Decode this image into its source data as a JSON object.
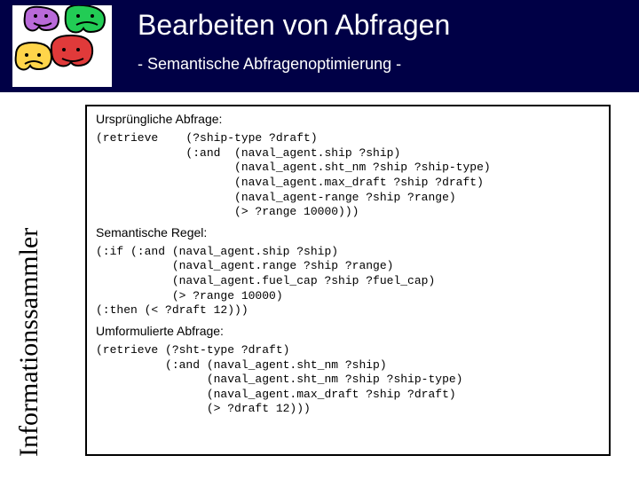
{
  "header": {
    "title": "Bearbeiten von Abfragen",
    "subtitle": "- Semantische Abfragenoptimierung -"
  },
  "side_label": "Informationssammler",
  "sections": {
    "original": {
      "label": "Ursprüngliche Abfrage:",
      "code": "(retrieve    (?ship-type ?draft)\n             (:and  (naval_agent.ship ?ship)\n                    (naval_agent.sht_nm ?ship ?ship-type)\n                    (naval_agent.max_draft ?ship ?draft)\n                    (naval_agent-range ?ship ?range)\n                    (> ?range 10000)))"
    },
    "rule": {
      "label": "Semantische Regel:",
      "code": "(:if (:and (naval_agent.ship ?ship)\n           (naval_agent.range ?ship ?range)\n           (naval_agent.fuel_cap ?ship ?fuel_cap)\n           (> ?range 10000)\n(:then (< ?draft 12)))"
    },
    "reformulated": {
      "label": "Umformulierte Abfrage:",
      "code": "(retrieve (?sht-type ?draft)\n          (:and (naval_agent.sht_nm ?ship)\n                (naval_agent.sht_nm ?ship ?ship-type)\n                (naval_agent.max_draft ?ship ?draft)\n                (> ?draft 12)))"
    }
  },
  "faces": {
    "purple": "#b96ad9",
    "green": "#22cc55",
    "red": "#e03a3a",
    "yellow": "#ffd54a",
    "stroke": "#000"
  }
}
